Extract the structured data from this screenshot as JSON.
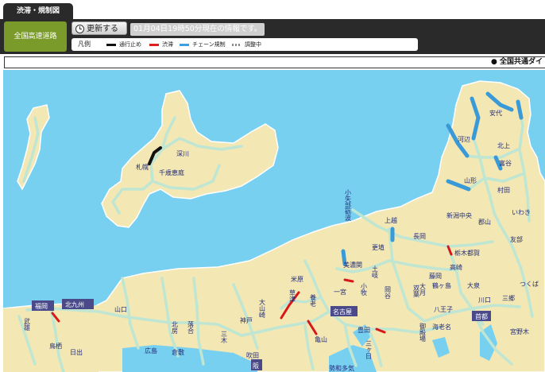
{
  "tabs": {
    "active_label": "渋滞・規制図"
  },
  "toolbar": {
    "region_label": "全国高速道路",
    "refresh_label": "更新する",
    "status_text": "01月04日19時50分現在の情報です。"
  },
  "legend": {
    "title": "凡例",
    "items": [
      {
        "label": "通行止め",
        "color": "#111111"
      },
      {
        "label": "渋滞",
        "color": "#e0201c"
      },
      {
        "label": "チェーン規制",
        "color": "#3aa0e0"
      },
      {
        "label": "調整中",
        "color": "#888888"
      }
    ]
  },
  "ticker": {
    "text": "● 全国共通ダイ"
  },
  "colors": {
    "sea": "#78d0f0",
    "land": "#f3e7b4",
    "road": "#bfe6d2",
    "chain": "#3a9ad8",
    "jam": "#d81818"
  },
  "map": {
    "places": [
      {
        "key": "sapporo",
        "text": "札幌",
        "box": false
      },
      {
        "key": "fukagawa",
        "text": "深川",
        "box": false
      },
      {
        "key": "chitose",
        "text": "千歳恵庭",
        "box": false
      },
      {
        "key": "anshi",
        "text": "安代",
        "box": false
      },
      {
        "key": "kawabe",
        "text": "河辺",
        "box": false
      },
      {
        "key": "kitakami",
        "text": "北上",
        "box": false
      },
      {
        "key": "tomiya",
        "text": "富谷",
        "box": false
      },
      {
        "key": "yamagata",
        "text": "山形",
        "box": false
      },
      {
        "key": "murata",
        "text": "村田",
        "box": false
      },
      {
        "key": "iwaki",
        "text": "いわき",
        "box": false
      },
      {
        "key": "niigata",
        "text": "新潟中央",
        "box": false
      },
      {
        "key": "joetsu",
        "text": "上越",
        "box": false
      },
      {
        "key": "nagaoka",
        "text": "長岡",
        "box": false
      },
      {
        "key": "koriyama",
        "text": "郡山",
        "box": false
      },
      {
        "key": "tomobe",
        "text": "友部",
        "box": false
      },
      {
        "key": "tochigi",
        "text": "栃木都賀",
        "box": false
      },
      {
        "key": "takasaki",
        "text": "高崎",
        "box": false
      },
      {
        "key": "fujioka",
        "text": "藤岡",
        "box": false
      },
      {
        "key": "ohizumi",
        "text": "大泉",
        "box": false
      },
      {
        "key": "tsukuba",
        "text": "つくば",
        "box": false
      },
      {
        "key": "tsuruga",
        "text": "鶴ヶ島",
        "box": false
      },
      {
        "key": "kawaguchi",
        "text": "川口",
        "box": false
      },
      {
        "key": "misato",
        "text": "三郷",
        "box": false
      },
      {
        "key": "hachioji",
        "text": "八王子",
        "box": false
      },
      {
        "key": "shuto",
        "text": "首都",
        "box": true
      },
      {
        "key": "ebina",
        "text": "海老名",
        "box": false
      },
      {
        "key": "miyanoki",
        "text": "宮野木",
        "box": false
      },
      {
        "key": "koshiba",
        "text": "小矢部砺波",
        "box": false
      },
      {
        "key": "mino",
        "text": "美濃関",
        "box": false
      },
      {
        "key": "okaya",
        "text": "岡谷",
        "box": false
      },
      {
        "key": "sarasawa",
        "text": "更埴",
        "box": false
      },
      {
        "key": "futaba",
        "text": "双葉",
        "box": false
      },
      {
        "key": "otsuki",
        "text": "大月",
        "box": false
      },
      {
        "key": "komaki",
        "text": "小牧",
        "box": false
      },
      {
        "key": "tosa",
        "text": "土岐",
        "box": false
      },
      {
        "key": "ichinomiya",
        "text": "一宮",
        "box": false
      },
      {
        "key": "yoro",
        "text": "養老",
        "box": false
      },
      {
        "key": "maibara",
        "text": "米原",
        "box": false
      },
      {
        "key": "kusatsu",
        "text": "草津",
        "box": false
      },
      {
        "key": "nagoya",
        "text": "名古屋",
        "box": true
      },
      {
        "key": "kameyama",
        "text": "亀山",
        "box": false
      },
      {
        "key": "toyota",
        "text": "豊田",
        "box": false
      },
      {
        "key": "mikkabi",
        "text": "三ヶ日",
        "box": false
      },
      {
        "key": "gotenba",
        "text": "御殿場",
        "box": false
      },
      {
        "key": "ooyamazaki",
        "text": "大山崎",
        "box": false
      },
      {
        "key": "kobe",
        "text": "神戸",
        "box": false
      },
      {
        "key": "sanki",
        "text": "三木",
        "box": false
      },
      {
        "key": "suita",
        "text": "吹田",
        "box": false
      },
      {
        "key": "seiwa",
        "text": "勢和多気",
        "box": false
      },
      {
        "key": "fukuoka",
        "text": "福岡",
        "box": true
      },
      {
        "key": "kitakyushu",
        "text": "北九州",
        "box": true
      },
      {
        "key": "yamaguchi",
        "text": "山口",
        "box": false
      },
      {
        "key": "takeo",
        "text": "武雄",
        "box": false
      },
      {
        "key": "tosu",
        "text": "鳥栖",
        "box": false
      },
      {
        "key": "hita",
        "text": "日出",
        "box": false
      },
      {
        "key": "hiroshima",
        "text": "広島",
        "box": false
      },
      {
        "key": "kurashiki",
        "text": "倉敷",
        "box": false
      },
      {
        "key": "kitafusa",
        "text": "北房",
        "box": false
      },
      {
        "key": "ochiai",
        "text": "落合",
        "box": false
      },
      {
        "key": "osaka",
        "text": "阪",
        "box": true
      }
    ]
  }
}
